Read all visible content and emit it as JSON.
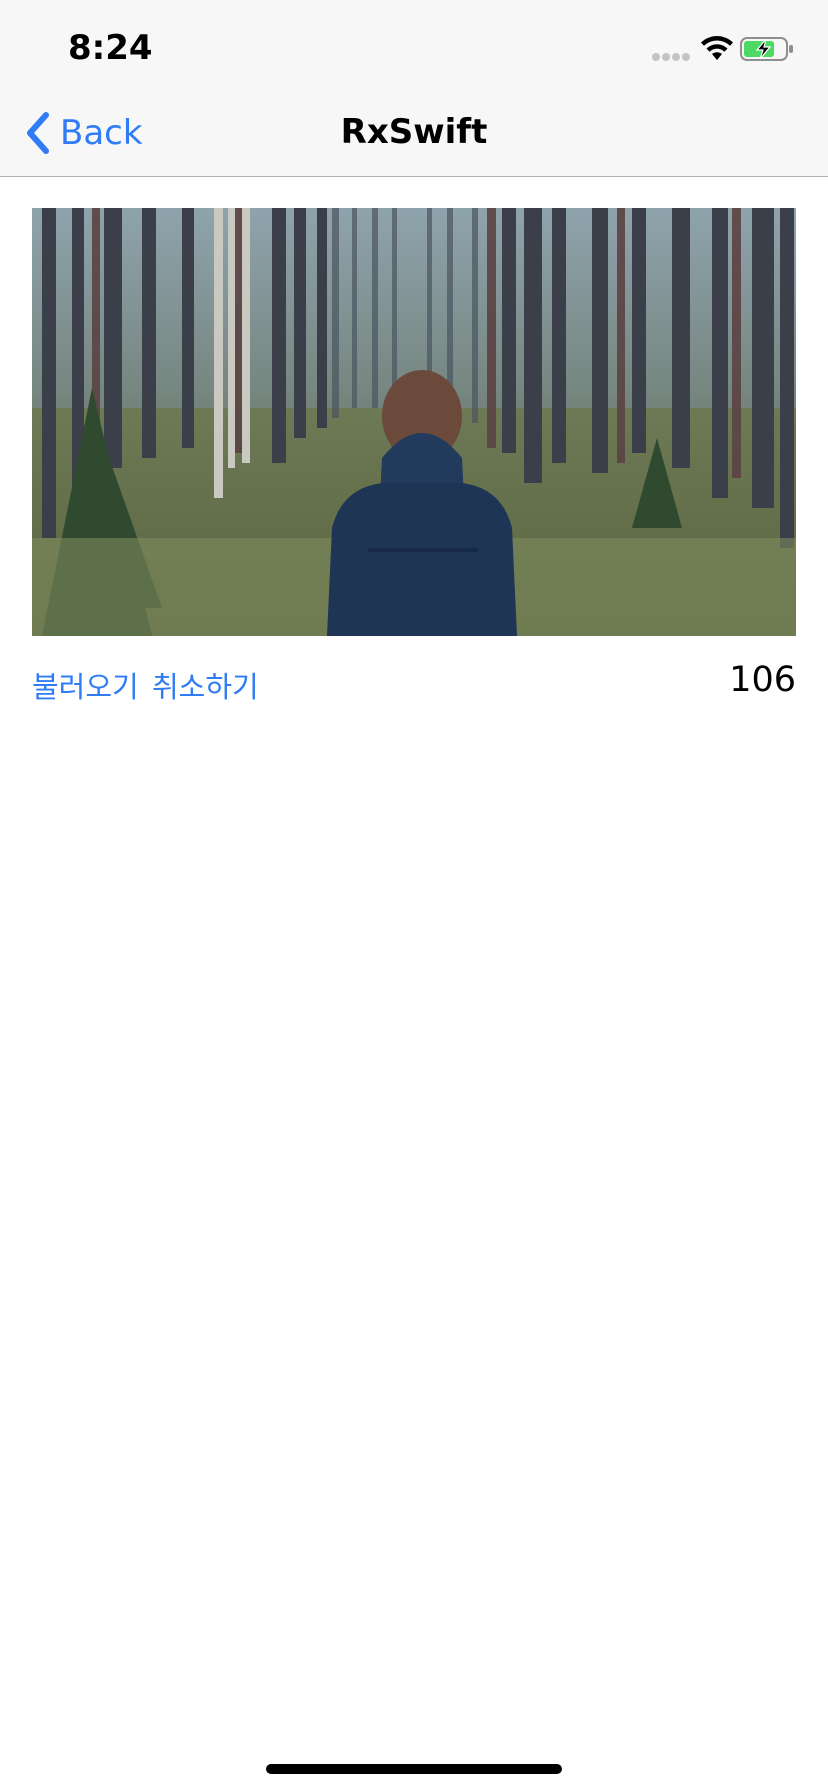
{
  "status_bar": {
    "time": "8:24",
    "icons": [
      "signal-dots-icon",
      "wifi-icon",
      "battery-charging-icon"
    ],
    "battery_color": "#4cd964"
  },
  "nav_bar": {
    "back_label": "Back",
    "title": "RxSwift"
  },
  "content": {
    "image": {
      "description_icon": "forest-photo"
    },
    "load_button_label": "불러오기",
    "cancel_button_label": "취소하기",
    "counter": "106"
  },
  "colors": {
    "accent": "#2f7cf6",
    "nav_background": "#f7f7f7"
  }
}
